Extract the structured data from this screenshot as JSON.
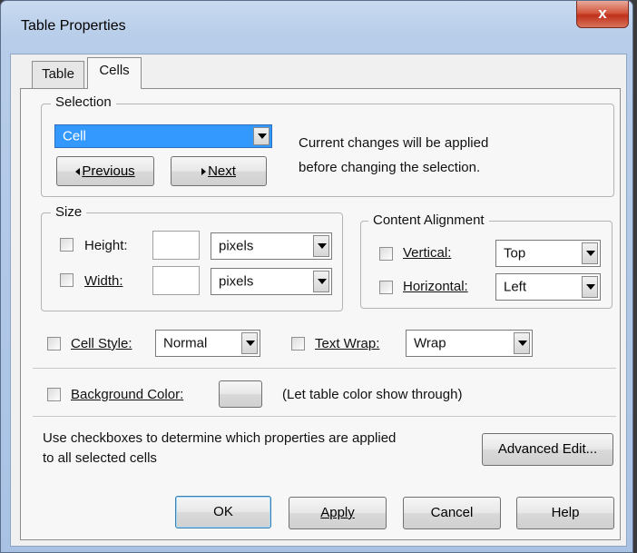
{
  "window": {
    "title": "Table Properties",
    "close_glyph": "x"
  },
  "tabs": [
    {
      "label": "Table",
      "active": false
    },
    {
      "label": "Cells",
      "active": true
    }
  ],
  "selection": {
    "legend": "Selection",
    "value": "Cell",
    "previous_label": "Previous",
    "next_label": "Next",
    "note_line1": "Current changes will be applied",
    "note_line2": "before changing the selection."
  },
  "size": {
    "legend": "Size",
    "height_label": "Height:",
    "height_value": "",
    "height_unit": "pixels",
    "width_label": "Width:",
    "width_value": "",
    "width_unit": "pixels"
  },
  "content_alignment": {
    "legend": "Content Alignment",
    "vertical_label": "Vertical:",
    "vertical_value": "Top",
    "horizontal_label": "Horizontal:",
    "horizontal_value": "Left"
  },
  "cell_style": {
    "label": "Cell Style:",
    "value": "Normal"
  },
  "text_wrap": {
    "label": "Text Wrap:",
    "value": "Wrap"
  },
  "background": {
    "label": "Background Color:",
    "note": "(Let table color show through)"
  },
  "hint_line1": "Use checkboxes to determine which properties are applied",
  "hint_line2": "to all selected cells",
  "advanced_edit_label": "Advanced Edit...",
  "footer": {
    "ok": "OK",
    "apply": "Apply",
    "cancel": "Cancel",
    "help": "Help"
  },
  "colors": {
    "selection_highlight": "#3399ff",
    "title_bar": "#b7cde9",
    "close_red": "#c0301a"
  }
}
